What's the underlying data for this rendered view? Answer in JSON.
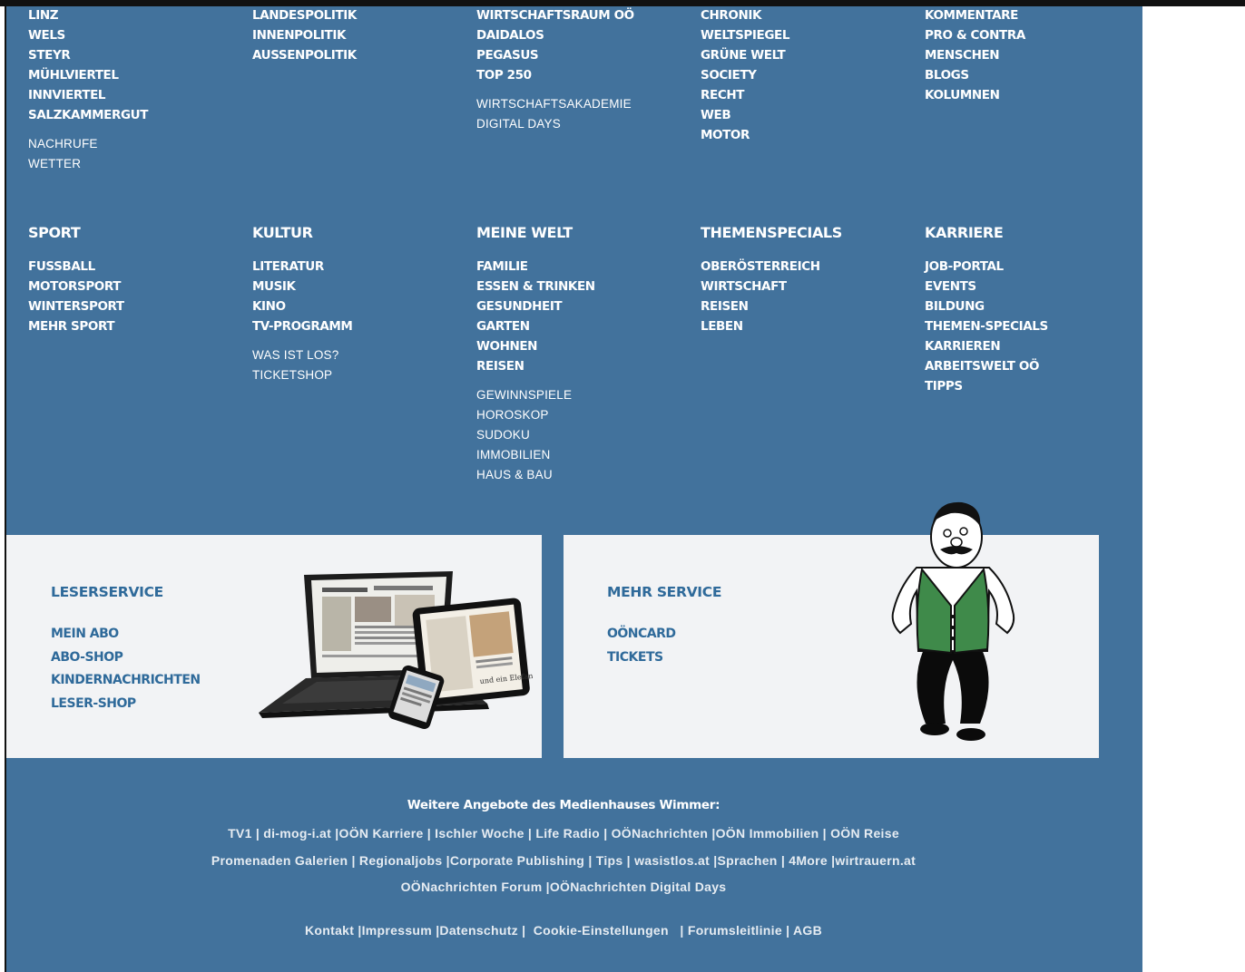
{
  "nav": {
    "col1": {
      "bold": [
        "LINZ",
        "WELS",
        "STEYR",
        "MÜHLVIERTEL",
        "INNVIERTEL",
        "SALZKAMMERGUT"
      ],
      "light": [
        "NACHRUFE",
        "WETTER"
      ]
    },
    "col2": {
      "bold": [
        "LANDESPOLITIK",
        "INNENPOLITIK",
        "AUSSENPOLITIK"
      ],
      "light": []
    },
    "col3": {
      "bold": [
        "WIRTSCHAFTSRAUM OÖ",
        "DAIDALOS",
        "PEGASUS",
        "TOP 250"
      ],
      "light": [
        "WIRTSCHAFTSAKADEMIE",
        "DIGITAL DAYS"
      ]
    },
    "col4": {
      "bold": [
        "CHRONIK",
        "WELTSPIEGEL",
        "GRÜNE WELT",
        "SOCIETY",
        "RECHT",
        "WEB",
        "MOTOR"
      ],
      "light": []
    },
    "col5": {
      "bold": [
        "KOMMENTARE",
        "PRO & CONTRA",
        "MENSCHEN",
        "BLOGS",
        "KOLUMNEN"
      ],
      "light": []
    }
  },
  "sections": [
    {
      "heading": "SPORT",
      "bold": [
        "FUSSBALL",
        "MOTORSPORT",
        "WINTERSPORT",
        "MEHR SPORT"
      ],
      "light": []
    },
    {
      "heading": "KULTUR",
      "bold": [
        "LITERATUR",
        "MUSIK",
        "KINO",
        "TV-PROGRAMM"
      ],
      "light": [
        "WAS IST LOS?",
        "TICKETSHOP"
      ]
    },
    {
      "heading": "MEINE WELT",
      "bold": [
        "FAMILIE",
        "ESSEN & TRINKEN",
        "GESUNDHEIT",
        "GARTEN",
        "WOHNEN",
        "REISEN"
      ],
      "light": [
        "GEWINNSPIELE",
        "HOROSKOP",
        "SUDOKU",
        "IMMOBILIEN",
        "HAUS & BAU"
      ]
    },
    {
      "heading": "THEMENSPECIALS",
      "bold": [
        "OBERÖSTERREICH",
        "WIRTSCHAFT",
        "REISEN",
        "LEBEN"
      ],
      "light": []
    },
    {
      "heading": "KARRIERE",
      "bold": [
        "JOB-PORTAL",
        "EVENTS",
        "BILDUNG",
        "THEMEN-SPECIALS",
        "KARRIEREN",
        "ARBEITSWELT OÖ",
        "TIPPS"
      ],
      "light": []
    }
  ],
  "leserservice": {
    "title": "LESERSERVICE",
    "links": [
      "MEIN ABO",
      "ABO-SHOP",
      "KINDERNACHRICHTEN",
      "LESER-SHOP"
    ],
    "tablet_text": "und ein Elefant"
  },
  "mehrservice": {
    "title": "MEHR SERVICE",
    "links": [
      "OÖNCARD",
      "TICKETS"
    ]
  },
  "footer": {
    "heading": "Weitere Angebote des Medienhauses Wimmer:",
    "line1": "TV1 | di-mog-i.at |OÖN Karriere | Ischler Woche | Life Radio | OÖNachrichten |OÖN Immobilien | OÖN Reise",
    "line2": "Promenaden Galerien | Regionaljobs |Corporate Publishing | Tips | wasistlos.at |Sprachen | 4More |wirtrauern.at",
    "line3": "OÖNachrichten Forum |OÖNachrichten Digital Days",
    "line4": "Kontakt |Impressum |Datenschutz |  Cookie-Einstellungen   | Forumsleitlinie | AGB"
  },
  "colors": {
    "panel": "#42729c",
    "service_bg": "#f2f3f5",
    "service_link": "#2f6a9a",
    "vest_green": "#3f8a4a"
  },
  "icons": [
    "devices-illustration",
    "mascot-illustration"
  ]
}
